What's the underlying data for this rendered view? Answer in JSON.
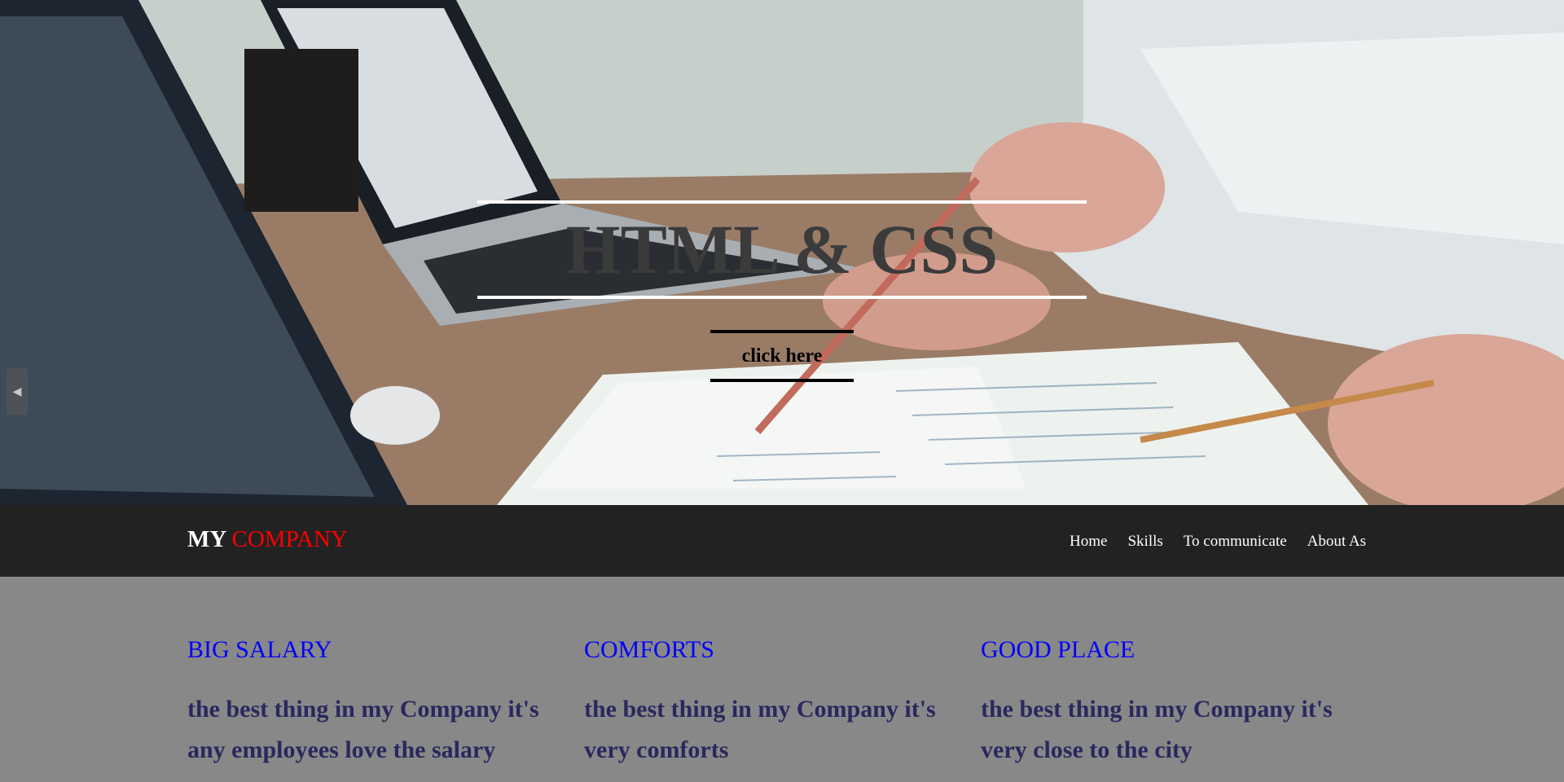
{
  "hero": {
    "title": "HTML & CSS",
    "button_label": "click here",
    "prev_icon": "◀"
  },
  "navbar": {
    "logo_first": "MY",
    "logo_second": "COMPANY",
    "links": [
      {
        "label": "Home"
      },
      {
        "label": "Skills"
      },
      {
        "label": "To communicate"
      },
      {
        "label": "About As"
      }
    ]
  },
  "features": [
    {
      "title": "BIG SALARY",
      "text": "the best thing in my Company it's any employees love the salary"
    },
    {
      "title": "COMFORTS",
      "text": "the best thing in my Company it's very comforts"
    },
    {
      "title": "GOOD PLACE",
      "text": "the best thing in my Company it's very close to the city"
    }
  ],
  "colors": {
    "navbar_bg": "#222222",
    "logo_accent": "#ff0000",
    "feature_title": "#0000ff",
    "feature_text": "#29285e",
    "page_bg": "#888888"
  }
}
